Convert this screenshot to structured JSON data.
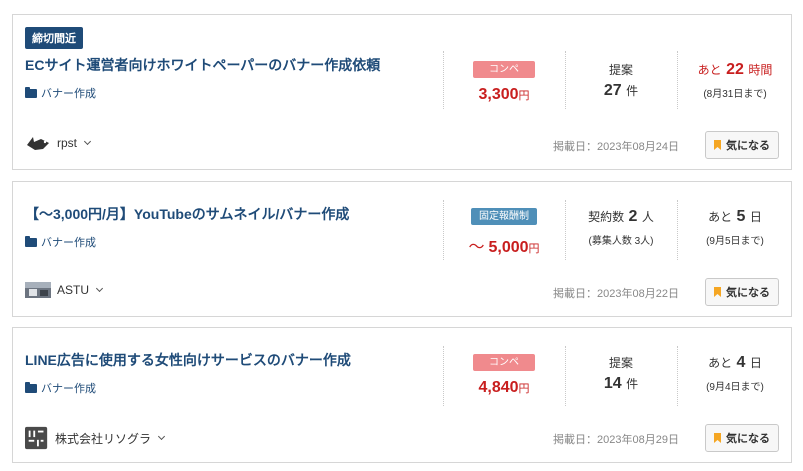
{
  "colors": {
    "title": "#1f4b78",
    "price": "#c81e1e",
    "compe_pill": "#f08a8d",
    "fixed_pill": "#4f8fb8",
    "bookmark": "#f5a623"
  },
  "listings": [
    {
      "badge": "締切間近",
      "title": "ECサイト運営者向けホワイトペーパーのバナー作成依頼",
      "category": "バナー作成",
      "category_icon": "folder-icon",
      "type_label": "コンペ",
      "price_prefix": "",
      "price": "3,300",
      "price_unit": "円",
      "count_label": "提案",
      "count": "27",
      "count_unit": "件",
      "count_sub": "",
      "deadline_prefix": "あと",
      "deadline_num": "22",
      "deadline_unit": "時間",
      "deadline_sub": "(8月31日まで)",
      "owner": "rpst",
      "owner_icon": "bird-avatar-icon",
      "posted": "掲載日：2023年08月24日",
      "fav_label": "気になる"
    },
    {
      "badge": "",
      "title": "【〜3,000円/月】YouTubeのサムネイル/バナー作成",
      "category": "バナー作成",
      "category_icon": "folder-icon",
      "type_label": "固定報酬制",
      "price_prefix": "〜",
      "price": "5,000",
      "price_unit": "円",
      "count_label": "契約数",
      "count": "2",
      "count_unit": "人",
      "count_sub": "(募集人数 3人)",
      "deadline_prefix": "あと",
      "deadline_num": "5",
      "deadline_unit": "日",
      "deadline_sub": "(9月5日まで)",
      "owner": "ASTU",
      "owner_icon": "photo-avatar-icon",
      "posted": "掲載日：2023年08月22日",
      "fav_label": "気になる"
    },
    {
      "badge": "",
      "title": "LINE広告に使用する女性向けサービスのバナー作成",
      "category": "バナー作成",
      "category_icon": "folder-icon",
      "type_label": "コンペ",
      "price_prefix": "",
      "price": "4,840",
      "price_unit": "円",
      "count_label": "提案",
      "count": "14",
      "count_unit": "件",
      "count_sub": "",
      "deadline_prefix": "あと",
      "deadline_num": "4",
      "deadline_unit": "日",
      "deadline_sub": "(9月4日まで)",
      "owner": "株式会社リソグラ",
      "owner_icon": "logo-avatar-icon",
      "posted": "掲載日：2023年08月29日",
      "fav_label": "気になる"
    }
  ]
}
